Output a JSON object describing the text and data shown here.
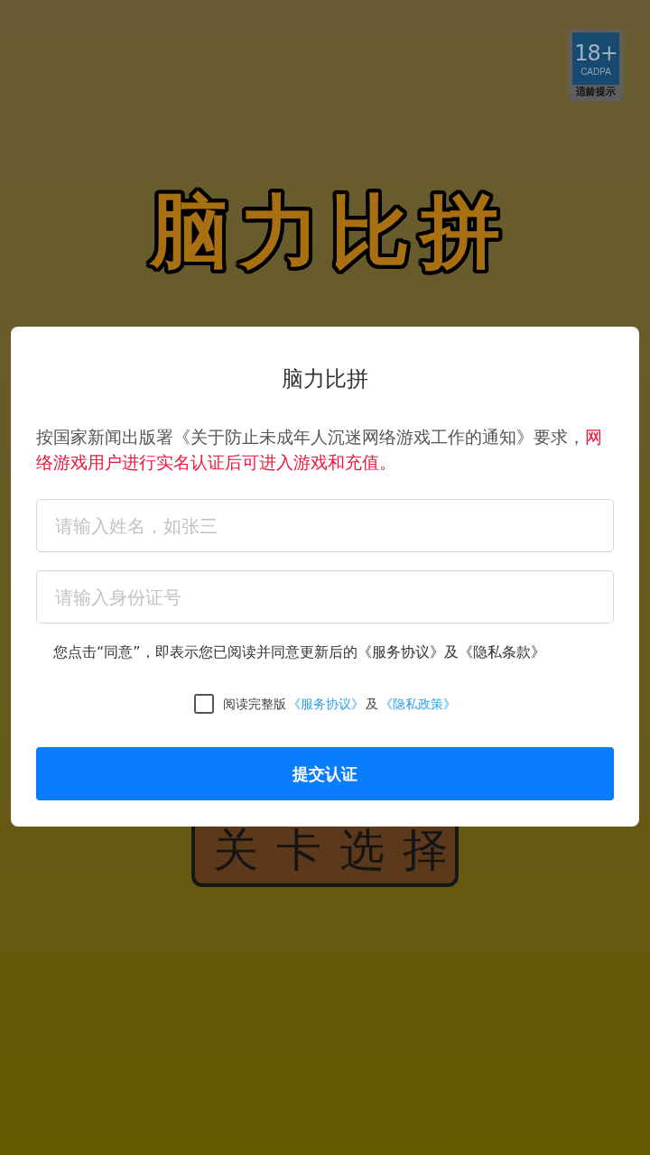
{
  "age_badge": {
    "rating": "18+",
    "org": "CADPA",
    "label": "适龄提示"
  },
  "game_title": "脑力比拼",
  "level_select_button": {
    "label": "关卡选择"
  },
  "dialog": {
    "title": "脑力比拼",
    "notice": {
      "text": "按国家新闻出版署《关于防止未成年人沉迷网络游戏工作的通知》要求，",
      "highlight": "网络游戏用户进行实名认证后可进入游戏和充值。"
    },
    "fields": [
      {
        "placeholder": "请输入姓名，如张三"
      },
      {
        "placeholder": "请输入身份证号"
      }
    ],
    "consent_text": "您点击“同意”，即表示您已阅读并同意更新后的《服务协议》及《隐私条款》",
    "agreement": {
      "checked": false,
      "text": "阅读完整版",
      "links": [
        "《服务协议》",
        "《隐私政策》"
      ],
      "separator": "及"
    },
    "submit_button": "提交认证"
  }
}
